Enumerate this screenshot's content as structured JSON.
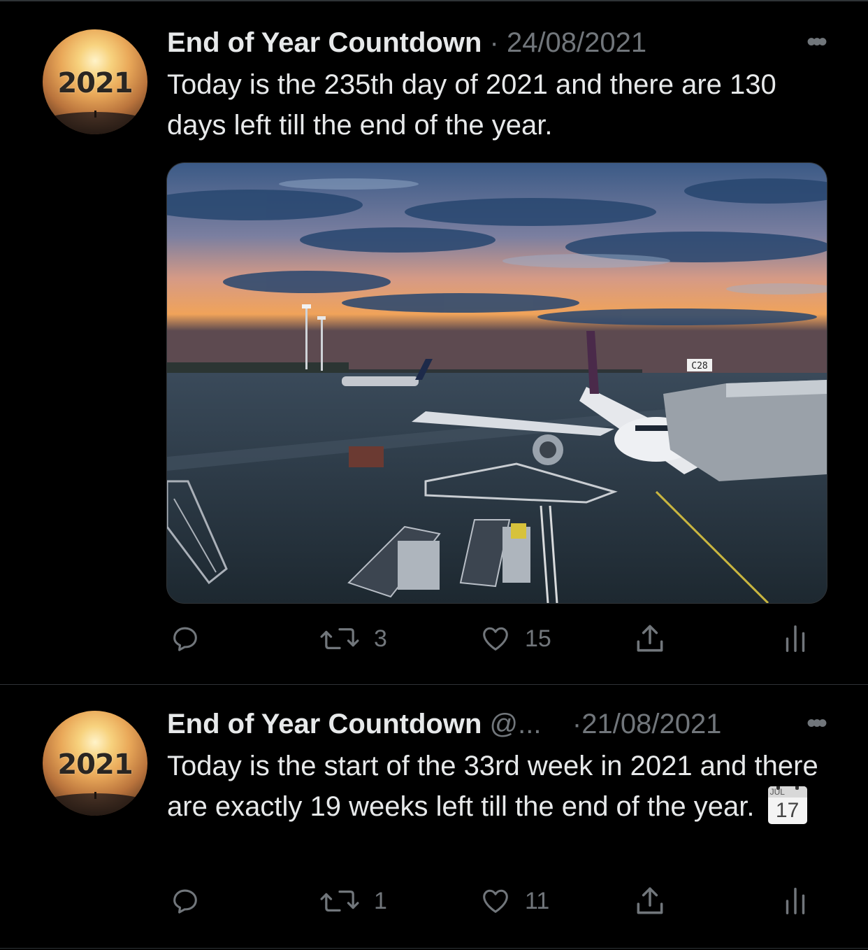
{
  "tweets": [
    {
      "author": "End of Year Countdown",
      "handle": "",
      "separator": "·",
      "date": "24/08/2021",
      "more": "•••",
      "avatar_text": "2021",
      "text": "Today is the 235th day of 2021 and there are 130 days left till the end of the year.",
      "image_sign": "C28",
      "replies": "",
      "retweets": "3",
      "likes": "15"
    },
    {
      "author": "End of Year Countdown",
      "handle": "@...",
      "separator": "·",
      "date": "21/08/2021",
      "more": "•••",
      "avatar_text": "2021",
      "text": "Today is the start of the 33rd week in 2021 and there are exactly 19 weeks left till the end of the year.",
      "calendar_month": "JUL",
      "calendar_day": "17",
      "replies": "",
      "retweets": "1",
      "likes": "11"
    }
  ],
  "icons": {
    "reply": "reply-icon",
    "retweet": "retweet-icon",
    "like": "heart-icon",
    "share": "share-icon",
    "analytics": "analytics-icon"
  },
  "colors": {
    "background": "#000000",
    "text": "#e7e9ea",
    "secondary": "#71767b",
    "divider": "#2f3336"
  }
}
